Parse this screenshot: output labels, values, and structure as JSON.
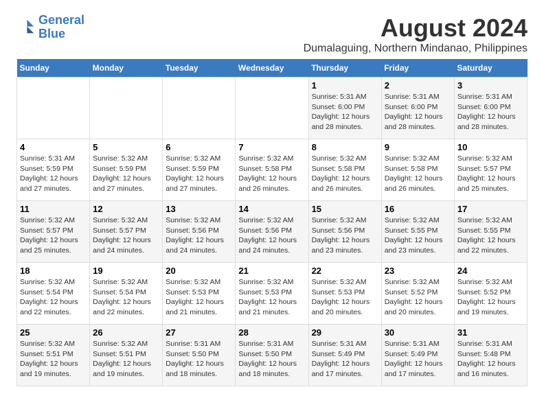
{
  "header": {
    "logo_line1": "General",
    "logo_line2": "Blue",
    "title": "August 2024",
    "subtitle": "Dumalaguing, Northern Mindanao, Philippines"
  },
  "weekdays": [
    "Sunday",
    "Monday",
    "Tuesday",
    "Wednesday",
    "Thursday",
    "Friday",
    "Saturday"
  ],
  "weeks": [
    [
      {
        "day": "",
        "info": ""
      },
      {
        "day": "",
        "info": ""
      },
      {
        "day": "",
        "info": ""
      },
      {
        "day": "",
        "info": ""
      },
      {
        "day": "1",
        "info": "Sunrise: 5:31 AM\nSunset: 6:00 PM\nDaylight: 12 hours\nand 28 minutes."
      },
      {
        "day": "2",
        "info": "Sunrise: 5:31 AM\nSunset: 6:00 PM\nDaylight: 12 hours\nand 28 minutes."
      },
      {
        "day": "3",
        "info": "Sunrise: 5:31 AM\nSunset: 6:00 PM\nDaylight: 12 hours\nand 28 minutes."
      }
    ],
    [
      {
        "day": "4",
        "info": "Sunrise: 5:31 AM\nSunset: 5:59 PM\nDaylight: 12 hours\nand 27 minutes."
      },
      {
        "day": "5",
        "info": "Sunrise: 5:32 AM\nSunset: 5:59 PM\nDaylight: 12 hours\nand 27 minutes."
      },
      {
        "day": "6",
        "info": "Sunrise: 5:32 AM\nSunset: 5:59 PM\nDaylight: 12 hours\nand 27 minutes."
      },
      {
        "day": "7",
        "info": "Sunrise: 5:32 AM\nSunset: 5:58 PM\nDaylight: 12 hours\nand 26 minutes."
      },
      {
        "day": "8",
        "info": "Sunrise: 5:32 AM\nSunset: 5:58 PM\nDaylight: 12 hours\nand 26 minutes."
      },
      {
        "day": "9",
        "info": "Sunrise: 5:32 AM\nSunset: 5:58 PM\nDaylight: 12 hours\nand 26 minutes."
      },
      {
        "day": "10",
        "info": "Sunrise: 5:32 AM\nSunset: 5:57 PM\nDaylight: 12 hours\nand 25 minutes."
      }
    ],
    [
      {
        "day": "11",
        "info": "Sunrise: 5:32 AM\nSunset: 5:57 PM\nDaylight: 12 hours\nand 25 minutes."
      },
      {
        "day": "12",
        "info": "Sunrise: 5:32 AM\nSunset: 5:57 PM\nDaylight: 12 hours\nand 24 minutes."
      },
      {
        "day": "13",
        "info": "Sunrise: 5:32 AM\nSunset: 5:56 PM\nDaylight: 12 hours\nand 24 minutes."
      },
      {
        "day": "14",
        "info": "Sunrise: 5:32 AM\nSunset: 5:56 PM\nDaylight: 12 hours\nand 24 minutes."
      },
      {
        "day": "15",
        "info": "Sunrise: 5:32 AM\nSunset: 5:56 PM\nDaylight: 12 hours\nand 23 minutes."
      },
      {
        "day": "16",
        "info": "Sunrise: 5:32 AM\nSunset: 5:55 PM\nDaylight: 12 hours\nand 23 minutes."
      },
      {
        "day": "17",
        "info": "Sunrise: 5:32 AM\nSunset: 5:55 PM\nDaylight: 12 hours\nand 22 minutes."
      }
    ],
    [
      {
        "day": "18",
        "info": "Sunrise: 5:32 AM\nSunset: 5:54 PM\nDaylight: 12 hours\nand 22 minutes."
      },
      {
        "day": "19",
        "info": "Sunrise: 5:32 AM\nSunset: 5:54 PM\nDaylight: 12 hours\nand 22 minutes."
      },
      {
        "day": "20",
        "info": "Sunrise: 5:32 AM\nSunset: 5:53 PM\nDaylight: 12 hours\nand 21 minutes."
      },
      {
        "day": "21",
        "info": "Sunrise: 5:32 AM\nSunset: 5:53 PM\nDaylight: 12 hours\nand 21 minutes."
      },
      {
        "day": "22",
        "info": "Sunrise: 5:32 AM\nSunset: 5:53 PM\nDaylight: 12 hours\nand 20 minutes."
      },
      {
        "day": "23",
        "info": "Sunrise: 5:32 AM\nSunset: 5:52 PM\nDaylight: 12 hours\nand 20 minutes."
      },
      {
        "day": "24",
        "info": "Sunrise: 5:32 AM\nSunset: 5:52 PM\nDaylight: 12 hours\nand 19 minutes."
      }
    ],
    [
      {
        "day": "25",
        "info": "Sunrise: 5:32 AM\nSunset: 5:51 PM\nDaylight: 12 hours\nand 19 minutes."
      },
      {
        "day": "26",
        "info": "Sunrise: 5:32 AM\nSunset: 5:51 PM\nDaylight: 12 hours\nand 19 minutes."
      },
      {
        "day": "27",
        "info": "Sunrise: 5:31 AM\nSunset: 5:50 PM\nDaylight: 12 hours\nand 18 minutes."
      },
      {
        "day": "28",
        "info": "Sunrise: 5:31 AM\nSunset: 5:50 PM\nDaylight: 12 hours\nand 18 minutes."
      },
      {
        "day": "29",
        "info": "Sunrise: 5:31 AM\nSunset: 5:49 PM\nDaylight: 12 hours\nand 17 minutes."
      },
      {
        "day": "30",
        "info": "Sunrise: 5:31 AM\nSunset: 5:49 PM\nDaylight: 12 hours\nand 17 minutes."
      },
      {
        "day": "31",
        "info": "Sunrise: 5:31 AM\nSunset: 5:48 PM\nDaylight: 12 hours\nand 16 minutes."
      }
    ]
  ]
}
